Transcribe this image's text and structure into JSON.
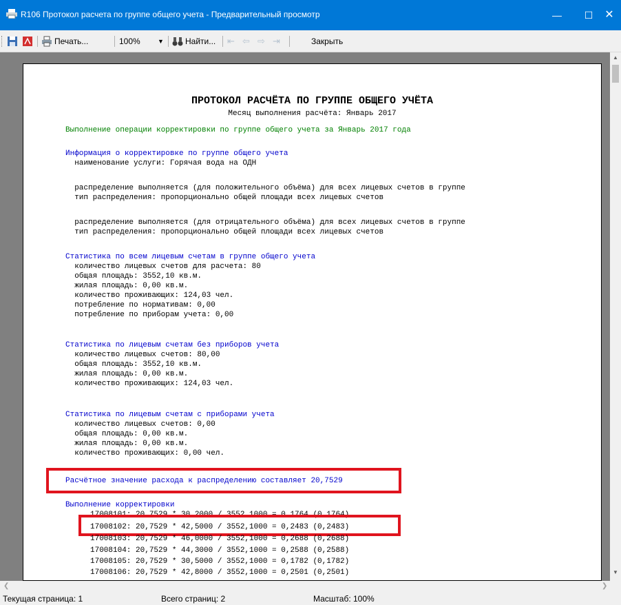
{
  "window": {
    "title": "R106 Протокол расчета по группе общего учета - Предварительный просмотр",
    "minimize_icon": "minimize-icon",
    "maximize_icon": "maximize-icon",
    "close_icon": "close-icon"
  },
  "toolbar": {
    "print_label": "Печать...",
    "zoom_value": "100%",
    "find_label": "Найти...",
    "close_label": "Закрыть"
  },
  "document": {
    "title": "ПРОТОКОЛ РАСЧЁТА ПО ГРУППЕ ОБЩЕГО УЧЁТА",
    "subtitle": "Месяц выполнения расчёта: Январь 2017",
    "operation": "Выполнение операции корректировки по группе общего учета за Январь 2017 года",
    "info_header": "Информация о корректировке по группе общего учета",
    "service": "  наименование услуги: Горячая вода на ОДН",
    "pos_dist": "  распределение выполняется (для положительного объёма) для всех лицевых счетов в группе",
    "pos_type": "  тип распределения: пропорционально общей площади всех лицевых счетов",
    "neg_dist": "  распределение выполняется (для отрицательного объёма) для всех лицевых счетов в группе",
    "neg_type": "  тип распределения: пропорционально общей площади всех лицевых счетов",
    "stats_all_header": "Статистика по всем лицевым счетам в группе общего учета",
    "stats_all": [
      "  количество лицевых счетов для расчета: 80",
      "  общая площадь: 3552,10 кв.м.",
      "  жилая площадь: 0,00 кв.м.",
      "  количество проживающих: 124,03 чел.",
      "  потребление по нормативам: 0,00",
      "  потребление по приборам учета: 0,00"
    ],
    "stats_nometer_header": "Статистика по лицевым счетам без приборов учета",
    "stats_nometer": [
      "  количество лицевых счетов: 80,00",
      "  общая площадь: 3552,10 кв.м.",
      "  жилая площадь: 0,00 кв.м.",
      "  количество проживающих: 124,03 чел."
    ],
    "stats_meter_header": "Статистика по лицевым счетам с приборами учета",
    "stats_meter": [
      "  количество лицевых счетов: 0,00",
      "  общая площадь: 0,00 кв.м.",
      "  жилая площадь: 0,00 кв.м.",
      "  количество проживающих: 0,00 чел."
    ],
    "calc_value": "Расчётное значение расхода к распределению составляет 20,7529",
    "correction_header": "Выполнение корректировки",
    "corrections": [
      "17008101: 20,7529 * 30,2000 / 3552,1000 = 0,1764 (0,1764)",
      "17008102: 20,7529 * 42,5000 / 3552,1000 = 0,2483 (0,2483)",
      "17008103: 20,7529 * 46,0000 / 3552,1000 = 0,2688 (0,2688)",
      "17008104: 20,7529 * 44,3000 / 3552,1000 = 0,2588 (0,2588)",
      "17008105: 20,7529 * 30,5000 / 3552,1000 = 0,1782 (0,1782)",
      "17008106: 20,7529 * 42,8000 / 3552,1000 = 0,2501 (0,2501)"
    ]
  },
  "status": {
    "current_page": "Текущая страница: 1",
    "total_pages": "Всего страниц: 2",
    "zoom": "Масштаб: 100%"
  },
  "colors": {
    "titlebar": "#0078d7",
    "highlight_box": "#e0141e",
    "heading_blue": "#0000cc",
    "operation_green": "#008000"
  }
}
